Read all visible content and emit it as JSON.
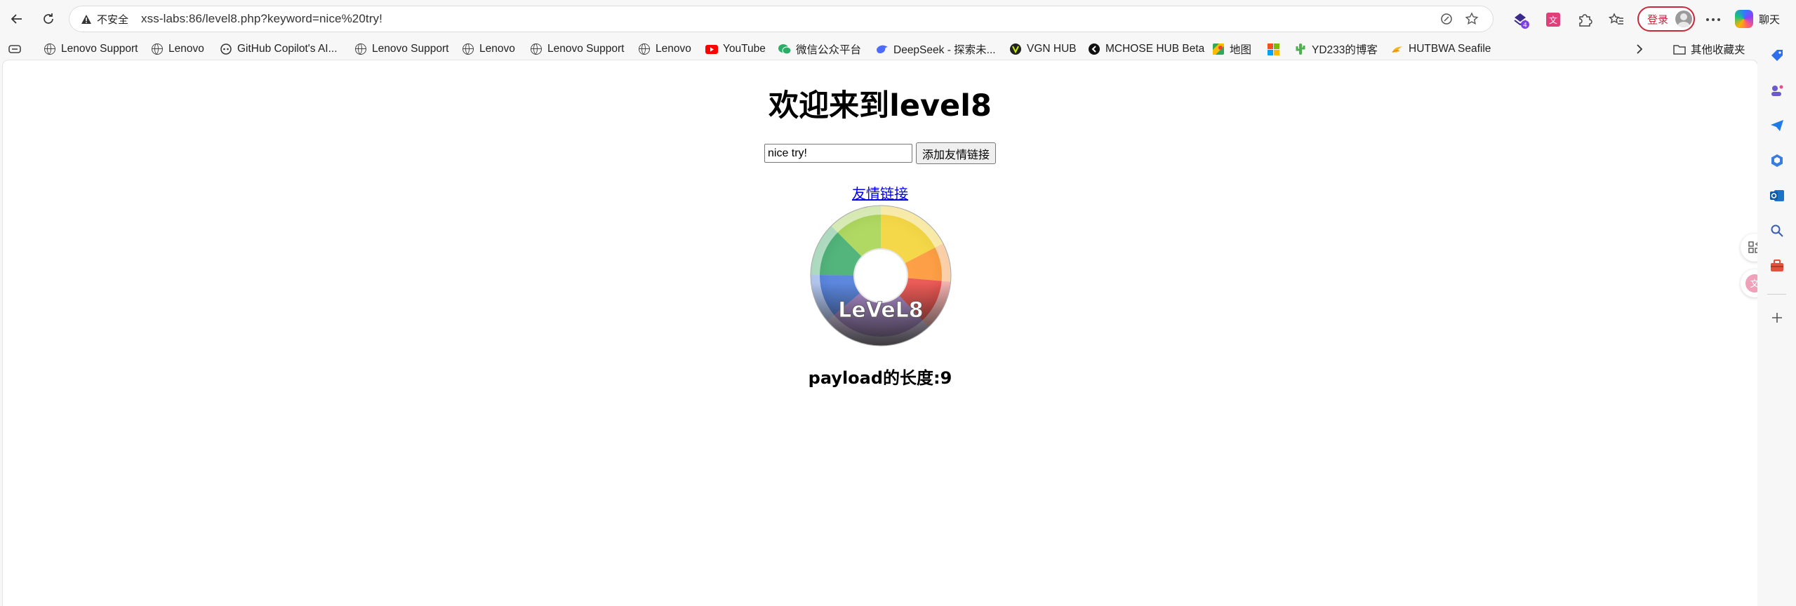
{
  "browser": {
    "security_label": "不安全",
    "url": "xss-labs:86/level8.php?keyword=nice%20try!",
    "login_label": "登录",
    "chat_label": "聊天",
    "bookmarks": [
      {
        "label": "Lenovo Support",
        "icon": "globe-icon"
      },
      {
        "label": "Lenovo",
        "icon": "globe-icon"
      },
      {
        "label": "GitHub Copilot's AI...",
        "icon": "copilot-icon"
      },
      {
        "label": "Lenovo Support",
        "icon": "globe-icon"
      },
      {
        "label": "Lenovo",
        "icon": "globe-icon"
      },
      {
        "label": "Lenovo Support",
        "icon": "globe-icon"
      },
      {
        "label": "Lenovo",
        "icon": "globe-icon"
      },
      {
        "label": "YouTube",
        "icon": "youtube-icon"
      },
      {
        "label": "微信公众平台",
        "icon": "wechat-icon"
      },
      {
        "label": "DeepSeek - 探索未...",
        "icon": "deepseek-icon"
      },
      {
        "label": "VGN HUB",
        "icon": "vgn-icon"
      },
      {
        "label": "MCHOSE HUB Beta",
        "icon": "mchose-icon"
      },
      {
        "label": "地图",
        "icon": "map-icon"
      },
      {
        "label": "",
        "icon": "microsoft-icon"
      },
      {
        "label": "YD233的博客",
        "icon": "cactus-icon"
      },
      {
        "label": "HUTBWA Seafile",
        "icon": "seafile-icon"
      }
    ],
    "other_favorites": "其他收藏夹",
    "extension_badge": "4"
  },
  "page": {
    "heading": "欢迎来到level8",
    "input_value": "nice try!",
    "submit_label": "添加友情链接",
    "link_text": "友情链接",
    "payload_text": "payload的长度:9",
    "disc_text": "LeVeL8"
  }
}
